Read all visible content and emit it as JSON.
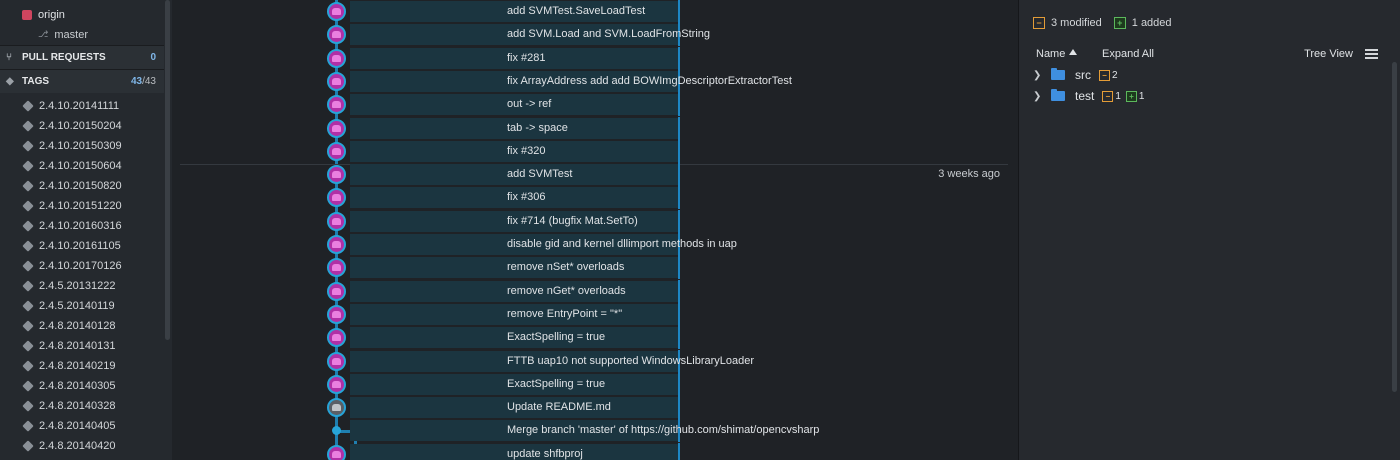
{
  "sidebar": {
    "origin_label": "origin",
    "master_label": "master",
    "pull_requests": {
      "label": "PULL REQUESTS",
      "count": "0"
    },
    "tags": {
      "label": "TAGS",
      "shown": "43",
      "total": "/43"
    },
    "tag_items": [
      "2.4.10.20141111",
      "2.4.10.20150204",
      "2.4.10.20150309",
      "2.4.10.20150604",
      "2.4.10.20150820",
      "2.4.10.20151220",
      "2.4.10.20160316",
      "2.4.10.20161105",
      "2.4.10.20170126",
      "2.4.5.20131222",
      "2.4.5.20140119",
      "2.4.8.20140128",
      "2.4.8.20140131",
      "2.4.8.20140219",
      "2.4.8.20140305",
      "2.4.8.20140328",
      "2.4.8.20140405",
      "2.4.8.20140420"
    ]
  },
  "commits": [
    {
      "msg": "add SVMTest.SaveLoadTest",
      "time": ""
    },
    {
      "msg": "add SVM.Load and SVM.LoadFromString",
      "time": ""
    },
    {
      "msg": "fix #281",
      "time": ""
    },
    {
      "msg": "fix ArrayAddress add add BOWImgDescriptorExtractorTest",
      "time": ""
    },
    {
      "msg": "out -> ref",
      "time": ""
    },
    {
      "msg": "tab -> space",
      "time": ""
    },
    {
      "msg": "fix #320",
      "time": ""
    },
    {
      "msg": "add SVMTest",
      "time": "3 weeks ago"
    },
    {
      "msg": "fix #306",
      "time": ""
    },
    {
      "msg": "fix #714 (bugfix Mat.SetTo)",
      "time": ""
    },
    {
      "msg": "disable gid and kernel dllimport methods in uap",
      "time": ""
    },
    {
      "msg": "remove nSet* overloads",
      "time": ""
    },
    {
      "msg": "remove nGet* overloads",
      "time": ""
    },
    {
      "msg": "remove EntryPoint = \"*\"",
      "time": ""
    },
    {
      "msg": "ExactSpelling = true",
      "time": ""
    },
    {
      "msg": "FTTB uap10 not supported WindowsLibraryLoader",
      "time": ""
    },
    {
      "msg": "ExactSpelling = true",
      "time": ""
    },
    {
      "msg": "Update README.md",
      "time": ""
    },
    {
      "msg": "Merge branch 'master' of https://github.com/shimat/opencvsharp",
      "time": ""
    },
    {
      "msg": "update shfbproj",
      "time": ""
    }
  ],
  "right_panel": {
    "modified_count": "3 modified",
    "added_count": "1 added",
    "modified_icon": "−",
    "added_icon": "+",
    "toolbar": {
      "name": "Name",
      "expand_all": "Expand All",
      "tree_view": "Tree View"
    },
    "tree": [
      {
        "name": "src",
        "modified": "2",
        "added": ""
      },
      {
        "name": "test",
        "modified": "1",
        "added": "1"
      }
    ]
  },
  "colors": {
    "accent": "#1d87c5",
    "avatar": "#b02fa6",
    "modified": "#e39c37",
    "added": "#5cb85c",
    "folder": "#3f8fe0"
  }
}
